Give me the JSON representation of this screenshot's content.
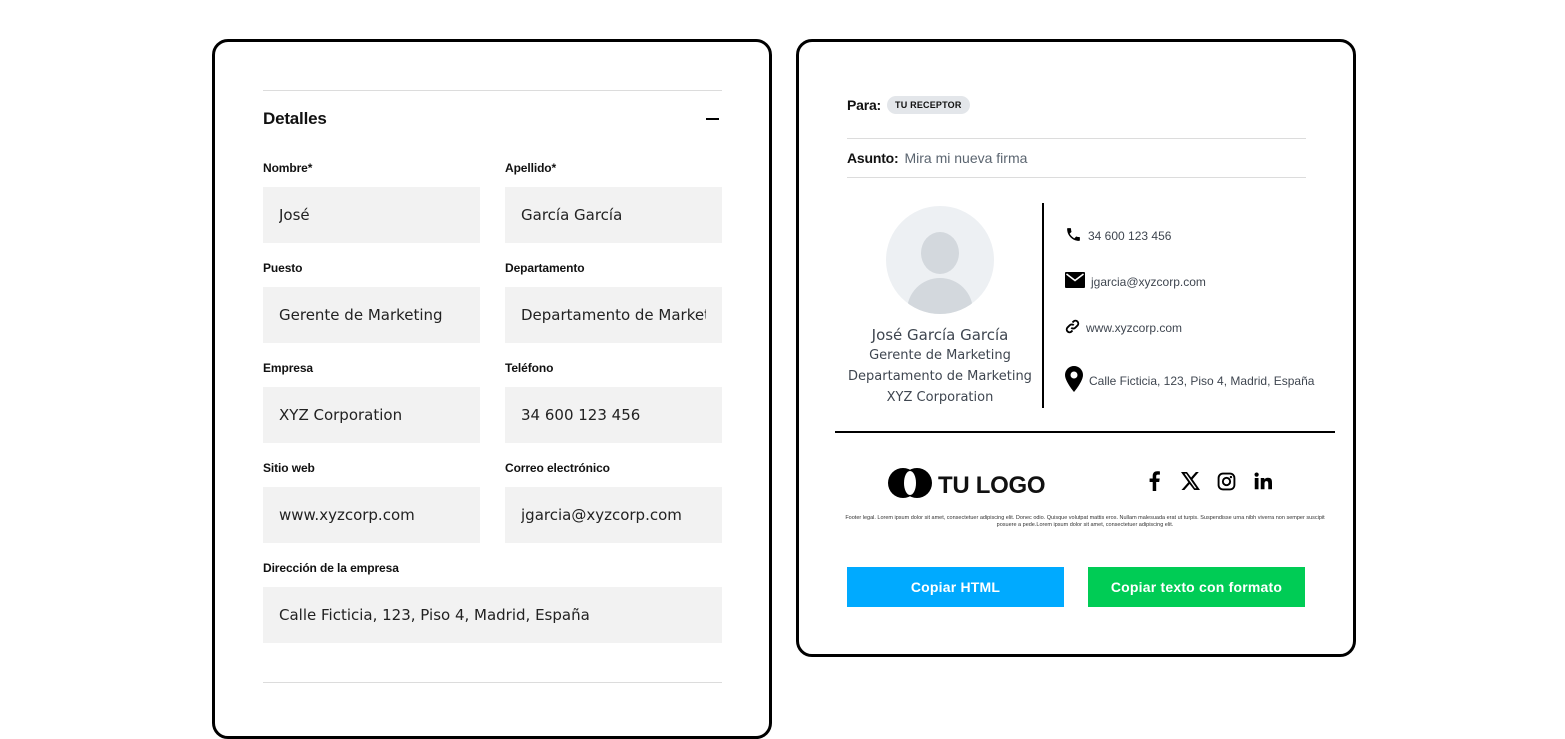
{
  "form": {
    "section_title": "Detalles",
    "fields": [
      {
        "label": "Nombre*",
        "value": "José"
      },
      {
        "label": "Apellido*",
        "value": "García García"
      },
      {
        "label": "Puesto",
        "value": "Gerente de Marketing"
      },
      {
        "label": "Departamento",
        "value": "Departamento de Marketing"
      },
      {
        "label": "Empresa",
        "value": "XYZ Corporation"
      },
      {
        "label": "Teléfono",
        "value": "34 600 123 456"
      },
      {
        "label": "Sitio web",
        "value": "www.xyzcorp.com"
      },
      {
        "label": "Correo electrónico",
        "value": "jgarcia@xyzcorp.com"
      },
      {
        "label": "Dirección de la empresa",
        "value": "Calle Ficticia, 123, Piso 4, Madrid, España"
      }
    ]
  },
  "preview": {
    "to_label": "Para:",
    "recipient": "TU RECEPTOR",
    "subject_label": "Asunto:",
    "subject": "Mira mi nueva firma",
    "signature": {
      "name": "José García García",
      "title": "Gerente de Marketing",
      "department": "Departamento de Marketing",
      "company": "XYZ Corporation",
      "phone": "34 600 123 456",
      "email": "jgarcia@xyzcorp.com",
      "website": "www.xyzcorp.com",
      "address": "Calle Ficticia, 123, Piso 4, Madrid, España",
      "logo_text": "TU LOGO",
      "socials": [
        "facebook-icon",
        "x-icon",
        "instagram-icon",
        "linkedin-icon"
      ],
      "legal": "Footer legal. Lorem ipsum dolor sit amet, consectetuer adipiscing elit. Donec odio. Quisque volutpat mattis eros. Nullam malesuada erat ut turpis. Suspendisse urna nibh viverra non semper suscipit posuere a pede.Lorem ipsum dolor sit amet, consectetuer adipiscing elit."
    },
    "copy_html_label": "Copiar HTML",
    "copy_rich_label": "Copiar texto con formato"
  },
  "colors": {
    "copy_html": "#00aaff",
    "copy_rich": "#00cc55",
    "input_bg": "#f2f2f2",
    "badge_bg": "#e3e6ea"
  }
}
